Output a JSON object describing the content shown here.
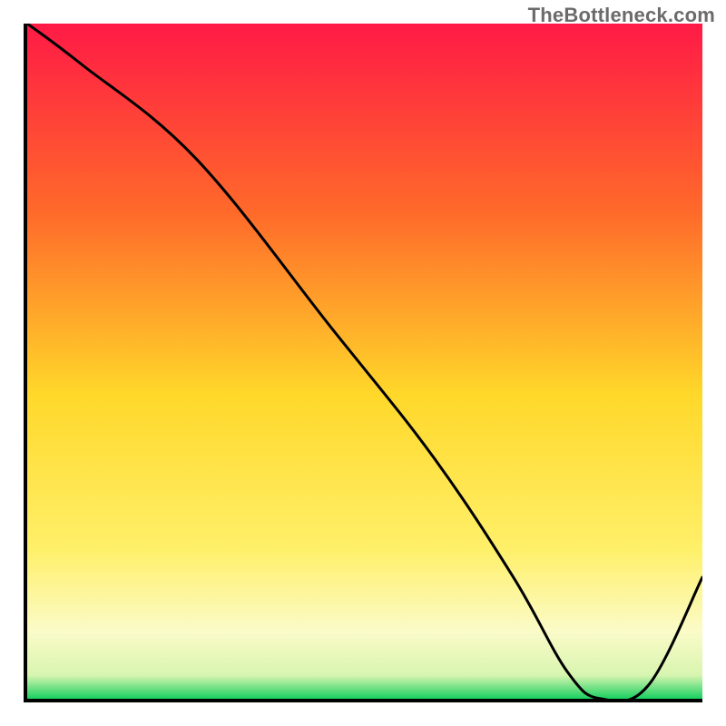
{
  "watermark": "TheBottleneck.com",
  "marker_label": "",
  "colors": {
    "top": "#ff1a46",
    "mid_upper": "#ff8a2a",
    "mid": "#ffd82a",
    "mid_lower": "#fff06a",
    "pale": "#fbfbc8",
    "green": "#18d060",
    "axis": "#000000",
    "curve": "#000000",
    "marker": "#c03030"
  },
  "chart_data": {
    "type": "line",
    "title": "",
    "xlabel": "",
    "ylabel": "",
    "xlim": [
      0,
      100
    ],
    "ylim": [
      0,
      100
    ],
    "series": [
      {
        "name": "bottleneck-curve",
        "x": [
          0,
          8,
          25,
          45,
          60,
          72,
          80,
          85,
          92,
          100
        ],
        "values": [
          100,
          94,
          80,
          55,
          36,
          18,
          4,
          0,
          2,
          18
        ]
      }
    ],
    "annotations": [
      {
        "name": "optimal-marker",
        "x": 83,
        "y": 0,
        "label": ""
      }
    ],
    "background_gradient_stops": [
      {
        "pos": 0.0,
        "color": "#ff1a46"
      },
      {
        "pos": 0.28,
        "color": "#ff6a2a"
      },
      {
        "pos": 0.55,
        "color": "#ffd82a"
      },
      {
        "pos": 0.78,
        "color": "#fff06a"
      },
      {
        "pos": 0.9,
        "color": "#fbfbc8"
      },
      {
        "pos": 0.965,
        "color": "#d8f5b0"
      },
      {
        "pos": 1.0,
        "color": "#18d060"
      }
    ]
  }
}
